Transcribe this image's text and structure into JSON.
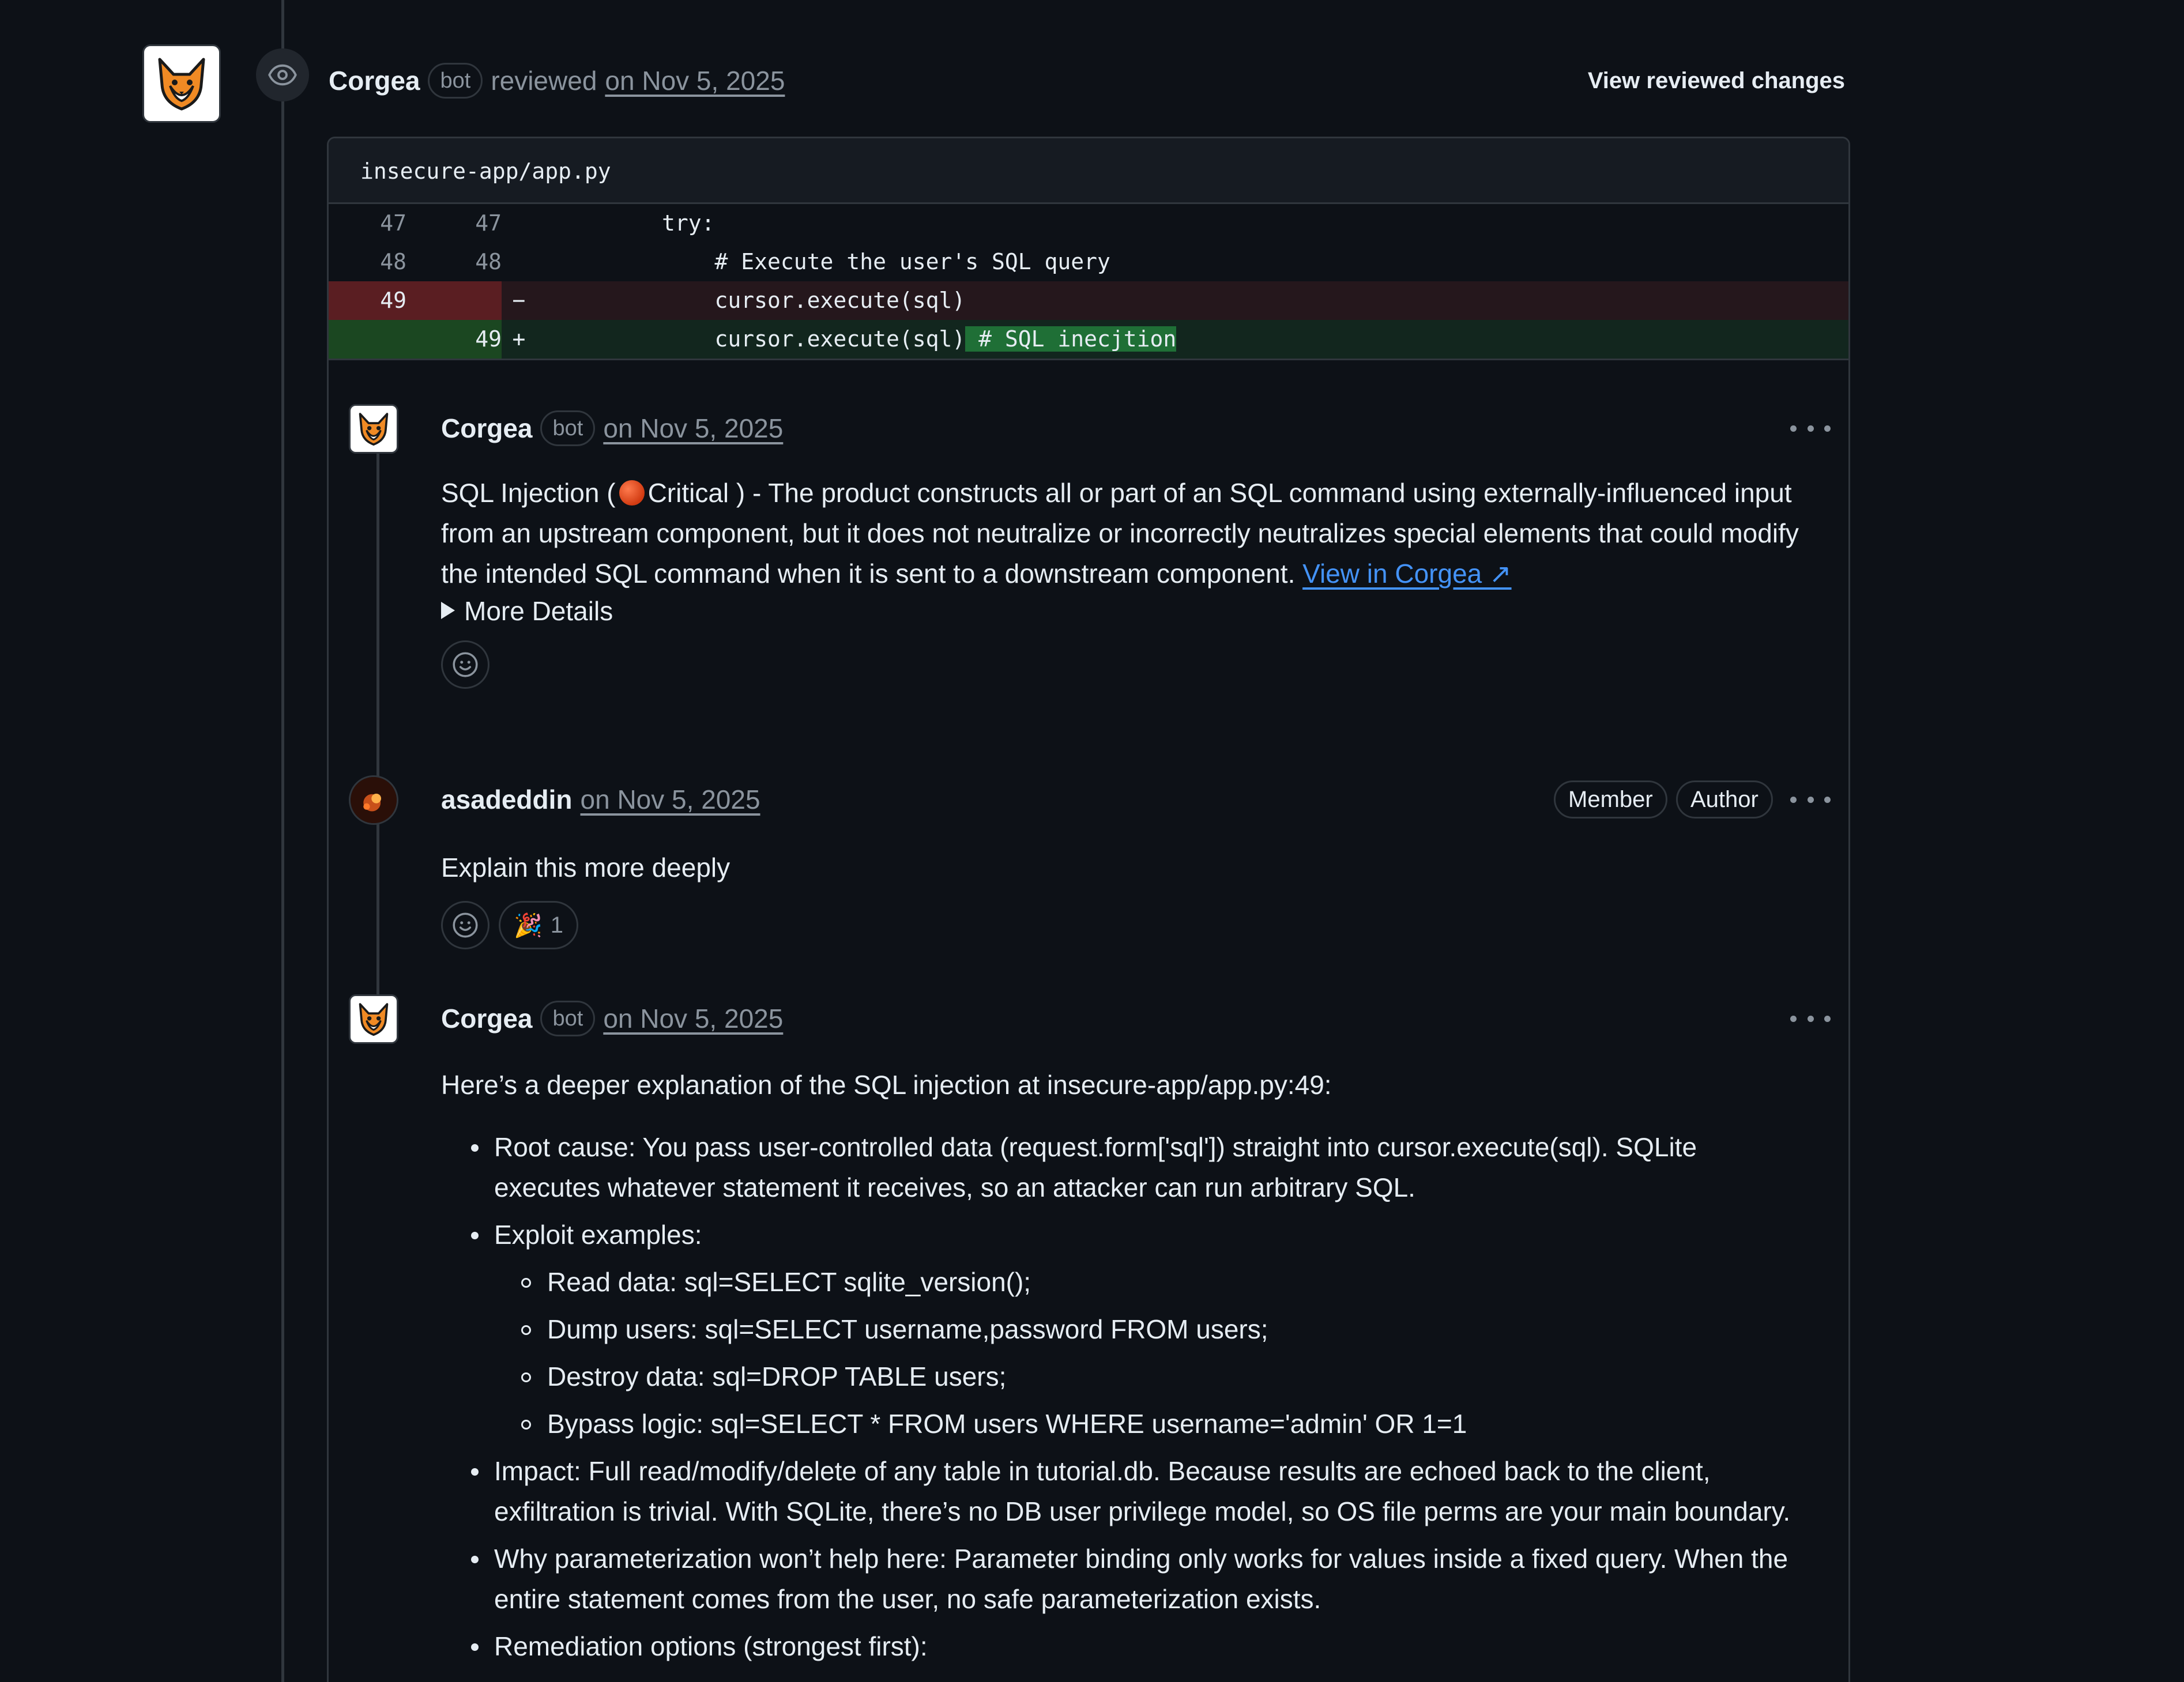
{
  "review": {
    "reviewer": "Corgea",
    "bot_label": "bot",
    "action": "reviewed",
    "date": "on Nov 5, 2025",
    "view_changes": "View reviewed changes"
  },
  "file": {
    "path": "insecure-app/app.py",
    "lines": [
      {
        "old": "47",
        "new": "47",
        "sign": "",
        "code": "        try:",
        "type": "ctx"
      },
      {
        "old": "48",
        "new": "48",
        "sign": "",
        "code": "            # Execute the user's SQL query",
        "type": "ctx"
      },
      {
        "old": "49",
        "new": "",
        "sign": "−",
        "code": "            cursor.execute(sql)",
        "type": "del"
      },
      {
        "old": "",
        "new": "49",
        "sign": "+",
        "code": "            cursor.execute(sql)",
        "added": " # SQL inecjtion",
        "type": "add"
      }
    ]
  },
  "comments": [
    {
      "author": "Corgea",
      "bot_label": "bot",
      "date": "on Nov 5, 2025",
      "body_prefix": "SQL Injection (",
      "severity": "Critical",
      "body_suffix": ") - The product constructs all or part of an SQL command using externally-influenced input from an upstream component, but it does not neutralize or incorrectly neutralizes special elements that could modify the intended SQL command when it is sent to a downstream component. ",
      "link": "View in Corgea ↗",
      "details": "More Details"
    },
    {
      "author": "asadeddin",
      "date": "on Nov 5, 2025",
      "badges": [
        "Member",
        "Author"
      ],
      "body": "Explain this more deeply",
      "reaction_emoji": "🎉",
      "reaction_count": "1"
    },
    {
      "author": "Corgea",
      "bot_label": "bot",
      "date": "on Nov 5, 2025",
      "intro": "Here’s a deeper explanation of the SQL injection at insecure-app/app.py:49:",
      "root_cause": "Root cause: You pass user-controlled data (request.form['sql']) straight into cursor.execute(sql). SQLite executes whatever statement it receives, so an attacker can run arbitrary SQL.",
      "exploit_title": "Exploit examples:",
      "exploits": [
        "Read data: sql=SELECT sqlite_version();",
        "Dump users: sql=SELECT username,password FROM users;",
        "Destroy data: sql=DROP TABLE users;",
        "Bypass logic: sql=SELECT * FROM users WHERE username='admin' OR 1=1"
      ],
      "impact": "Impact: Full read/modify/delete of any table in tutorial.db. Because results are echoed back to the client, exfiltration is trivial. With SQLite, there’s no DB user privilege model, so OS file perms are your main boundary.",
      "why": "Why parameterization won’t help here: Parameter binding only works for values inside a fixed query. When the entire statement comes from the user, no safe parameterization exists.",
      "remediation": "Remediation options (strongest first):"
    }
  ],
  "colors": {
    "background": "#0d1117",
    "border": "#30363d",
    "link": "#4493f8",
    "deleted_line": "#5a1e22",
    "added_line": "#1b4721"
  }
}
